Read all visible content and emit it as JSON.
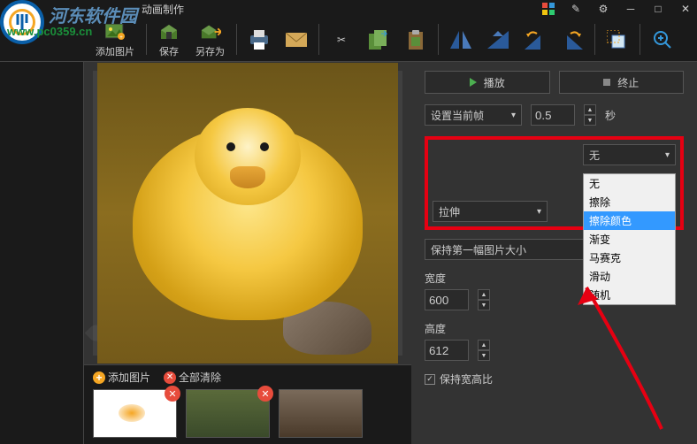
{
  "titlebar": {
    "title": "动画制作"
  },
  "logo": {
    "text": "河东软件园",
    "url": "www.pc0359.cn"
  },
  "toolbar": {
    "add_image": "添加图片",
    "save": "保存",
    "save_as": "另存为"
  },
  "thumbs": {
    "add_image": "添加图片",
    "clear_all": "全部清除"
  },
  "controls": {
    "play": "播放",
    "stop": "终止",
    "set_frame": "设置当前帧",
    "duration_value": "0.5",
    "duration_unit": "秒",
    "transition_selected": "无",
    "transition_options": [
      "无",
      "擦除",
      "擦除颜色",
      "渐变",
      "马赛克",
      "滑动",
      "随机"
    ],
    "transition_highlight": "擦除颜色",
    "stretch": "拉伸",
    "keep_first": "保持第一幅图片大小",
    "width_label": "宽度",
    "width_value": "600",
    "height_label": "高度",
    "height_value": "612",
    "keep_ratio": "保持宽高比"
  }
}
